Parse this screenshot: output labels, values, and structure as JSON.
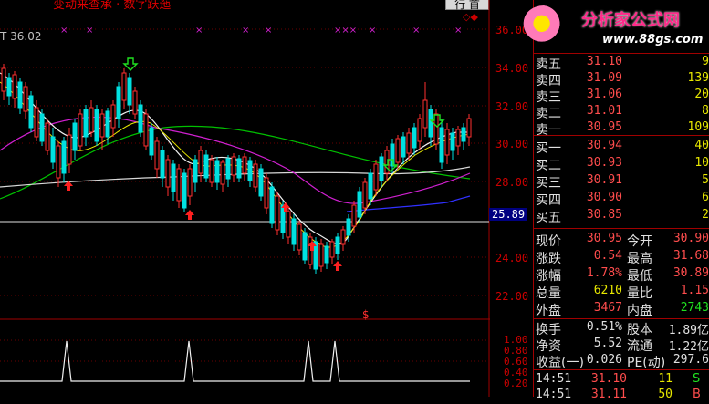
{
  "header": {
    "title_fragment": "变动来查承 · 数字跃迤",
    "top_button": "行 首",
    "top_marker": "◇◆",
    "watermark_brand": "分析家公式网",
    "watermark_url": "www.88gs.com"
  },
  "chart": {
    "top_value_label": "T 36.02",
    "price_axis": [
      "36.00",
      "34.00",
      "32.00",
      "30.00",
      "28.00",
      "26.00",
      "24.00",
      "22.00"
    ],
    "current_price_marker": "25.89",
    "sub_marker": "$",
    "indicator_axis": [
      "1.00",
      "0.80",
      "0.60",
      "0.40",
      "0.20"
    ]
  },
  "order_book": {
    "asks": [
      {
        "label": "卖五",
        "price": "31.10",
        "vol": "9"
      },
      {
        "label": "卖四",
        "price": "31.09",
        "vol": "139"
      },
      {
        "label": "卖三",
        "price": "31.06",
        "vol": "20"
      },
      {
        "label": "卖二",
        "price": "31.01",
        "vol": "8"
      },
      {
        "label": "卖一",
        "price": "30.95",
        "vol": "109"
      }
    ],
    "bids": [
      {
        "label": "买一",
        "price": "30.94",
        "vol": "40"
      },
      {
        "label": "买二",
        "price": "30.93",
        "vol": "10"
      },
      {
        "label": "买三",
        "price": "30.91",
        "vol": "5"
      },
      {
        "label": "买四",
        "price": "30.90",
        "vol": "6"
      },
      {
        "label": "买五",
        "price": "30.85",
        "vol": "2"
      }
    ]
  },
  "quote": {
    "rows": [
      {
        "l1": "现价",
        "v1": "30.95",
        "l2": "今开",
        "v2": "30.90"
      },
      {
        "l1": "涨跌",
        "v1": "0.54",
        "l2": "最高",
        "v2": "31.68"
      },
      {
        "l1": "涨幅",
        "v1": "1.78%",
        "l2": "最低",
        "v2": "30.89"
      },
      {
        "l1": "总量",
        "v1": "6210",
        "l2": "量比",
        "v2": "1.15"
      },
      {
        "l1": "外盘",
        "v1": "3467",
        "l2": "内盘",
        "v2": "2743"
      }
    ],
    "rows2": [
      {
        "l1": "换手",
        "v1": "0.51%",
        "l2": "股本",
        "v2": "1.89亿"
      },
      {
        "l1": "净资",
        "v1": "5.52",
        "l2": "流通",
        "v2": "1.22亿"
      },
      {
        "l1": "收益(一)",
        "v1": "0.026",
        "l2": "PE(动)",
        "v2": "297.6"
      }
    ]
  },
  "ticks": [
    {
      "time": "14:51",
      "price": "31.10",
      "vol": "11",
      "flag": "S"
    },
    {
      "time": "14:51",
      "price": "31.11",
      "vol": "50",
      "flag": "B"
    }
  ]
}
